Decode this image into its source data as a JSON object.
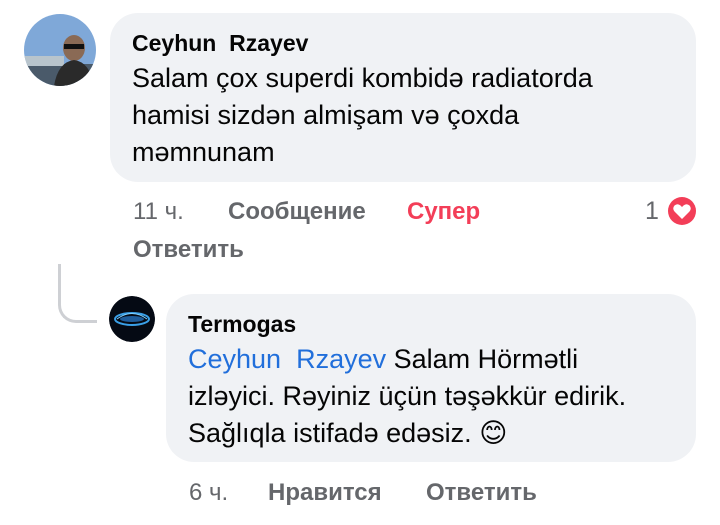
{
  "comment": {
    "author": "Ceyhun  Rzayev",
    "lines": [
      "Salam çox superdi kombidə radiatorda",
      "hamisi sizdən almişam və çoxda",
      "məmnunam"
    ],
    "time": "11 ч.",
    "message_label": "Сообщение",
    "reaction_label": "Супер",
    "reaction_count": "1",
    "reply_label": "Ответить",
    "colors": {
      "reaction": "#f33e58",
      "bubble": "#f0f2f5",
      "meta": "#65676b"
    }
  },
  "reply": {
    "author": "Termogas",
    "mention": "Ceyhun  Rzayev",
    "line1_rest": " Salam Hörmətli",
    "line2": "izləyici. Rəyiniz üçün təşəkkür edirik.",
    "line3": "Sağlıqla istifadə edəsiz.",
    "emoji": "😊",
    "time": "6 ч.",
    "like_label": "Нравится",
    "reply_label": "Ответить",
    "colors": {
      "mention": "#216fdb"
    }
  }
}
